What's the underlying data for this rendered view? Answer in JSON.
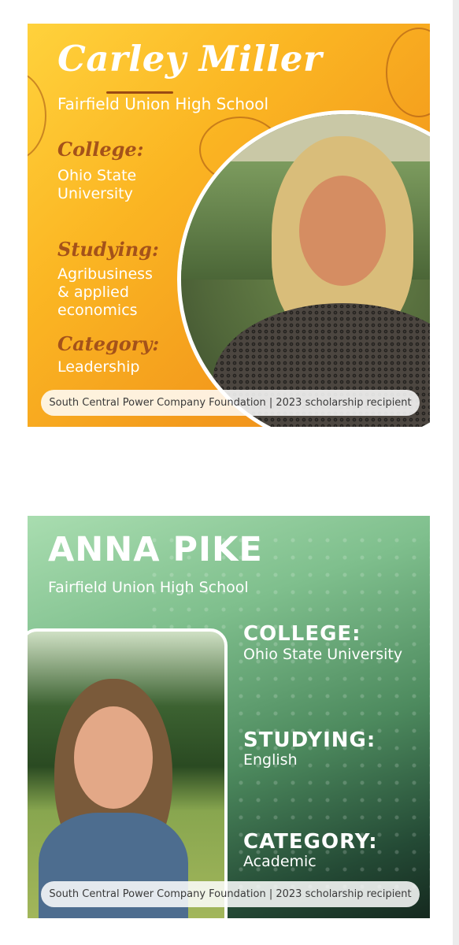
{
  "card1": {
    "name": "Carley Miller",
    "school": "Fairfield Union High School",
    "college_label": "College:",
    "college_value": [
      "Ohio State",
      "University"
    ],
    "studying_label": "Studying:",
    "studying_value": [
      "Agribusiness",
      "& applied",
      "economics"
    ],
    "category_label": "Category:",
    "category_value": "Leadership",
    "footer": "South Central Power Company Foundation | 2023 scholarship recipient",
    "colors": {
      "background": "#f6a920",
      "label": "#a4521a",
      "text": "#ffffff"
    }
  },
  "card2": {
    "name": "ANNA PIKE",
    "school": "Fairfield Union High School",
    "college_label": "COLLEGE:",
    "college_value": "Ohio State University",
    "studying_label": "STUDYING:",
    "studying_value": "English",
    "category_label": "CATEGORY:",
    "category_value": "Academic",
    "footer": "South Central Power Company Foundation | 2023 scholarship recipient",
    "colors": {
      "background": "#4d8a5e",
      "text": "#ffffff"
    }
  }
}
